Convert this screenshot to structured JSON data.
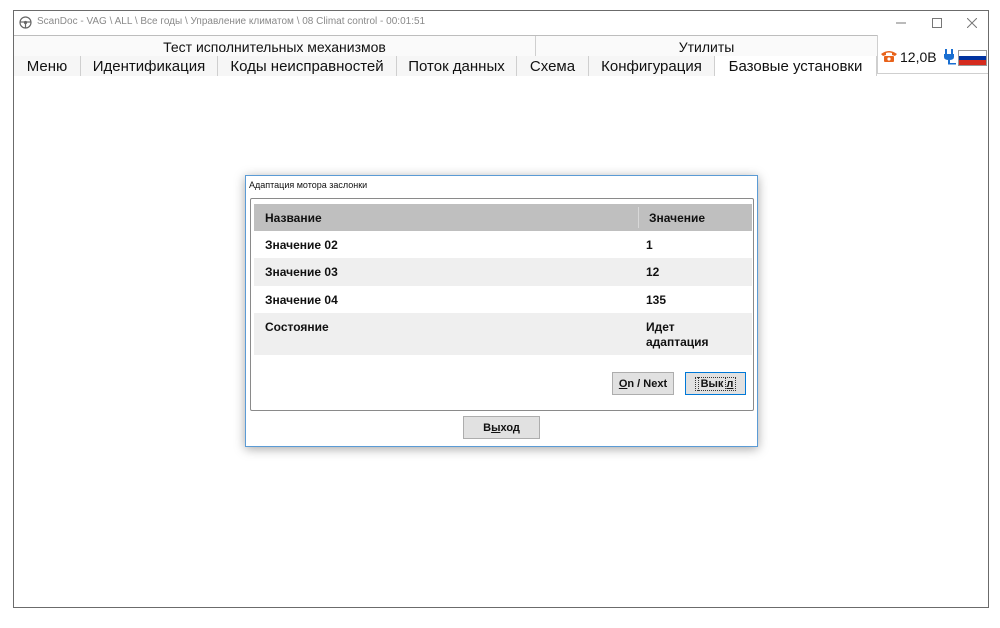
{
  "window": {
    "title": "ScanDoc - VAG \\ ALL \\ Все годы \\ Управление климатом \\ 08 Climat control - 00:01:51"
  },
  "groups": [
    "Тест исполнительных механизмов",
    "Утилиты"
  ],
  "tabs": [
    {
      "label": "Меню"
    },
    {
      "label": "Идентификация"
    },
    {
      "label": "Коды неисправностей"
    },
    {
      "label": "Поток данных"
    },
    {
      "label": "Схема"
    },
    {
      "label": "Конфигурация"
    },
    {
      "label": "Базовые установки",
      "active": true
    }
  ],
  "status": {
    "voltage": "12,0В",
    "icons": [
      "phone-icon",
      "plug-icon",
      "russian-flag"
    ],
    "colors": {
      "phone": "#e8621a",
      "plug": "#1a6fd1",
      "flag_white": "#ffffff",
      "flag_blue": "#0033a0",
      "flag_red": "#d52b1e"
    }
  },
  "dialog": {
    "title": "Адаптация мотора заслонки",
    "columns": [
      "Название",
      "Значение"
    ],
    "rows": [
      {
        "name": "Значение 02",
        "value": "1"
      },
      {
        "name": "Значение 03",
        "value": "12"
      },
      {
        "name": "Значение 04",
        "value": "135"
      },
      {
        "name": "Состояние",
        "value": "Идет адаптация"
      }
    ],
    "buttons": {
      "next_mnemonic": "O",
      "next_rest": "n / Next",
      "off_pre": "Вык",
      "off_mnemonic": "л",
      "exit_pre": "В",
      "exit_mnemonic": "ы",
      "exit_rest": "ход"
    }
  }
}
